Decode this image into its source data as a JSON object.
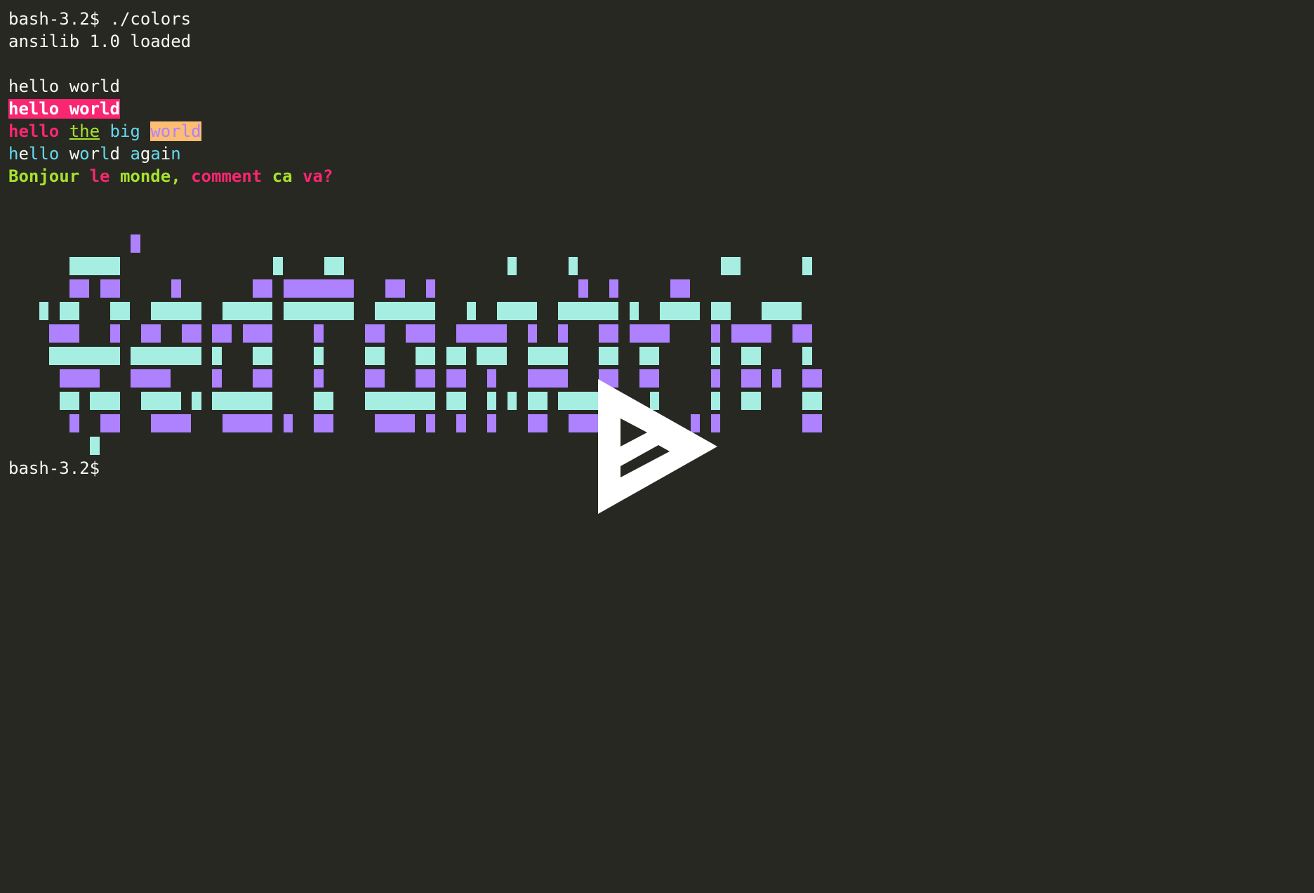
{
  "terminal": {
    "lines": [
      [
        {
          "text": "bash-3.2$ ./colors",
          "style": "white"
        }
      ],
      [
        {
          "text": "ansilib 1.0 loaded",
          "style": "white"
        }
      ],
      [],
      [
        {
          "text": "hello world",
          "style": "white"
        }
      ],
      [
        {
          "text": "hello world",
          "style": "hl-pink"
        }
      ],
      [
        {
          "text": "hello",
          "style": "pink b"
        },
        {
          "text": " ",
          "style": ""
        },
        {
          "text": "the",
          "style": "green ul"
        },
        {
          "text": " big ",
          "style": "cyan"
        },
        {
          "text": "world",
          "style": "hl-orange"
        }
      ],
      [
        {
          "text": "h",
          "style": "cyan"
        },
        {
          "text": "e",
          "style": "white"
        },
        {
          "text": "ll",
          "style": "cyan"
        },
        {
          "text": "o",
          "style": "cyan"
        },
        {
          "text": " ",
          "style": ""
        },
        {
          "text": "w",
          "style": "white"
        },
        {
          "text": "o",
          "style": "cyan"
        },
        {
          "text": "r",
          "style": "white"
        },
        {
          "text": "l",
          "style": "cyan"
        },
        {
          "text": "d",
          "style": "white"
        },
        {
          "text": " ",
          "style": ""
        },
        {
          "text": "a",
          "style": "cyan"
        },
        {
          "text": "g",
          "style": "white"
        },
        {
          "text": "a",
          "style": "cyan"
        },
        {
          "text": "i",
          "style": "white"
        },
        {
          "text": "n",
          "style": "cyan"
        }
      ],
      [
        {
          "text": "Bonjour ",
          "style": "green b"
        },
        {
          "text": "le ",
          "style": "pink b"
        },
        {
          "text": "monde, ",
          "style": "green b"
        },
        {
          "text": "comment ",
          "style": "pink b"
        },
        {
          "text": "ca ",
          "style": "green b"
        },
        {
          "text": "va?",
          "style": "pink b"
        }
      ]
    ],
    "prompt_end": "bash-3.2$"
  },
  "pixel_art": {
    "colors": {
      "mint": "#a6eee2",
      "violet": "#ae81ff"
    },
    "rows": [
      {
        "color": "violet",
        "runs": [
          [
            12,
            1
          ]
        ]
      },
      {
        "color": "mint",
        "runs": [
          [
            6,
            5
          ],
          [
            26,
            1
          ],
          [
            31,
            2
          ],
          [
            49,
            1
          ],
          [
            55,
            1
          ],
          [
            70,
            2
          ],
          [
            78,
            1
          ]
        ]
      },
      {
        "color": "violet",
        "runs": [
          [
            6,
            2
          ],
          [
            9,
            2
          ],
          [
            16,
            1
          ],
          [
            24,
            2
          ],
          [
            27,
            7
          ],
          [
            37,
            2
          ],
          [
            41,
            1
          ],
          [
            56,
            1
          ],
          [
            59,
            1
          ],
          [
            65,
            2
          ]
        ]
      },
      {
        "color": "mint",
        "runs": [
          [
            3,
            1
          ],
          [
            5,
            2
          ],
          [
            10,
            2
          ],
          [
            14,
            5
          ],
          [
            21,
            5
          ],
          [
            27,
            7
          ],
          [
            36,
            6
          ],
          [
            45,
            1
          ],
          [
            48,
            4
          ],
          [
            54,
            6
          ],
          [
            61,
            1
          ],
          [
            64,
            4
          ],
          [
            69,
            2
          ],
          [
            74,
            4
          ]
        ]
      },
      {
        "color": "violet",
        "runs": [
          [
            4,
            3
          ],
          [
            10,
            1
          ],
          [
            13,
            2
          ],
          [
            17,
            2
          ],
          [
            20,
            2
          ],
          [
            23,
            3
          ],
          [
            30,
            1
          ],
          [
            35,
            2
          ],
          [
            39,
            3
          ],
          [
            44,
            5
          ],
          [
            51,
            1
          ],
          [
            54,
            1
          ],
          [
            58,
            2
          ],
          [
            61,
            4
          ],
          [
            69,
            1
          ],
          [
            71,
            4
          ],
          [
            77,
            2
          ]
        ]
      },
      {
        "color": "mint",
        "runs": [
          [
            4,
            7
          ],
          [
            12,
            7
          ],
          [
            20,
            1
          ],
          [
            24,
            2
          ],
          [
            30,
            1
          ],
          [
            35,
            2
          ],
          [
            40,
            2
          ],
          [
            43,
            2
          ],
          [
            46,
            3
          ],
          [
            51,
            4
          ],
          [
            58,
            2
          ],
          [
            62,
            2
          ],
          [
            69,
            1
          ],
          [
            72,
            2
          ],
          [
            78,
            1
          ]
        ]
      },
      {
        "color": "violet",
        "runs": [
          [
            5,
            4
          ],
          [
            12,
            4
          ],
          [
            20,
            1
          ],
          [
            24,
            2
          ],
          [
            30,
            1
          ],
          [
            35,
            2
          ],
          [
            40,
            2
          ],
          [
            43,
            2
          ],
          [
            47,
            1
          ],
          [
            51,
            4
          ],
          [
            58,
            2
          ],
          [
            62,
            2
          ],
          [
            69,
            1
          ],
          [
            72,
            2
          ],
          [
            75,
            1
          ],
          [
            78,
            2
          ]
        ]
      },
      {
        "color": "mint",
        "runs": [
          [
            5,
            2
          ],
          [
            8,
            3
          ],
          [
            13,
            4
          ],
          [
            18,
            1
          ],
          [
            20,
            6
          ],
          [
            30,
            2
          ],
          [
            35,
            7
          ],
          [
            43,
            2
          ],
          [
            47,
            1
          ],
          [
            49,
            1
          ],
          [
            51,
            2
          ],
          [
            54,
            5
          ],
          [
            63,
            1
          ],
          [
            69,
            1
          ],
          [
            72,
            2
          ],
          [
            78,
            2
          ]
        ]
      },
      {
        "color": "violet",
        "runs": [
          [
            6,
            1
          ],
          [
            9,
            2
          ],
          [
            14,
            4
          ],
          [
            21,
            5
          ],
          [
            27,
            1
          ],
          [
            30,
            2
          ],
          [
            36,
            4
          ],
          [
            41,
            1
          ],
          [
            44,
            1
          ],
          [
            47,
            1
          ],
          [
            51,
            2
          ],
          [
            55,
            3
          ],
          [
            67,
            1
          ],
          [
            69,
            1
          ],
          [
            78,
            2
          ]
        ]
      },
      {
        "color": "mint",
        "runs": [
          [
            8,
            1
          ]
        ]
      }
    ]
  }
}
